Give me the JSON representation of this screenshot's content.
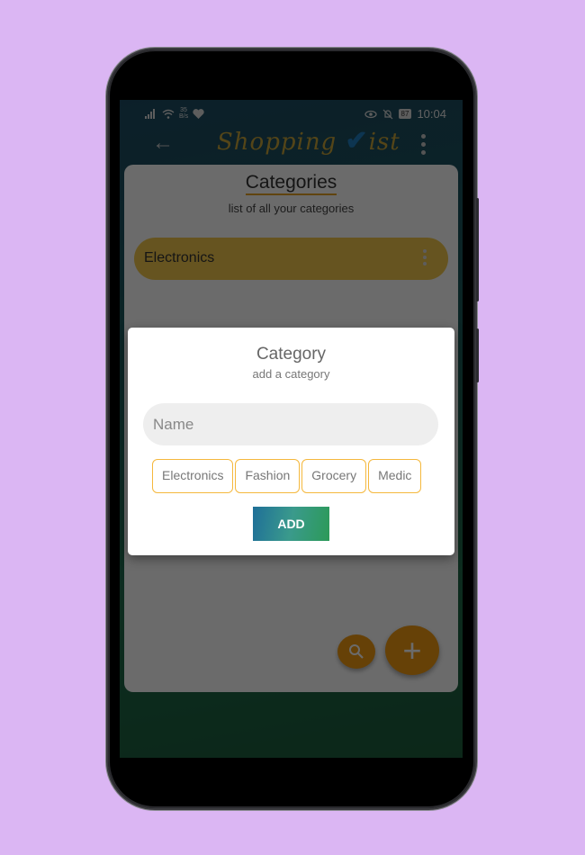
{
  "status_bar": {
    "network_speed_value": "35",
    "network_speed_unit": "B/s",
    "battery": "87",
    "time": "10:04"
  },
  "app_bar": {
    "logo_text_1": "Shopping",
    "logo_text_2": "ist",
    "back_icon": "arrow-left",
    "menu_icon": "more-vertical"
  },
  "page": {
    "title": "Categories",
    "subtitle": "list of all your categories",
    "categories": [
      {
        "label": "Electronics"
      }
    ],
    "colors": {
      "accent": "#f39c12",
      "item_bg": "#f4c94c"
    }
  },
  "fabs": {
    "search_icon": "search",
    "add_icon": "plus",
    "add_glyph": "+"
  },
  "dialog": {
    "title": "Category",
    "subtitle": "add a category",
    "name_placeholder": "Name",
    "name_value": "",
    "suggestions": [
      "Electronics",
      "Fashion",
      "Grocery",
      "Medic"
    ],
    "add_label": "ADD"
  }
}
